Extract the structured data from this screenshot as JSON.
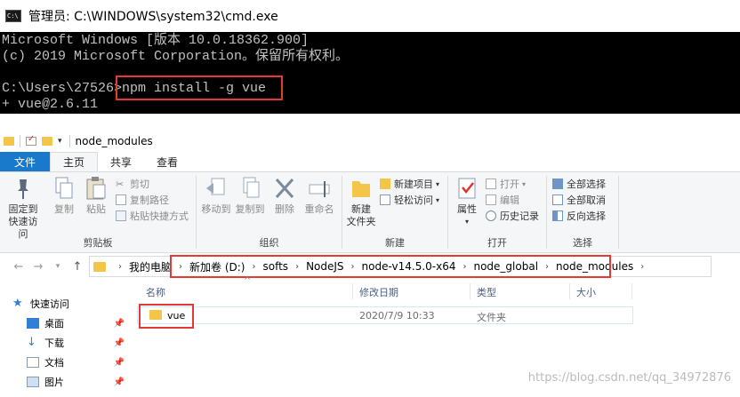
{
  "cmd": {
    "title": "管理员: C:\\WINDOWS\\system32\\cmd.exe",
    "lines": [
      "Microsoft Windows [版本 10.0.18362.900]",
      "(c) 2019 Microsoft Corporation。保留所有权利。",
      "",
      "C:\\Users\\27526>npm install -g vue",
      "+ vue@2.6.11"
    ]
  },
  "explorer": {
    "title": "node_modules",
    "tabs": [
      "文件",
      "主页",
      "共享",
      "查看"
    ],
    "ribbon": {
      "clipboard": {
        "label": "剪贴板",
        "pin_label": "固定到\n快速访问",
        "copy": "复制",
        "paste": "粘贴",
        "cut": "剪切",
        "copy_path": "复制路径",
        "paste_shortcut": "粘贴快捷方式"
      },
      "organize": {
        "label": "组织",
        "move_to": "移动到",
        "copy_to": "复制到",
        "delete": "删除",
        "rename": "重命名"
      },
      "new": {
        "label": "新建",
        "new_folder": "新建\n文件夹",
        "new_item": "新建项目",
        "easy_access": "轻松访问"
      },
      "open": {
        "label": "打开",
        "properties": "属性",
        "open": "打开",
        "edit": "编辑",
        "history": "历史记录"
      },
      "select": {
        "label": "选择",
        "select_all": "全部选择",
        "select_none": "全部取消",
        "invert": "反向选择"
      }
    },
    "address": [
      "我的电脑",
      "新加卷 (D:)",
      "softs",
      "NodeJS",
      "node-v14.5.0-x64",
      "node_global",
      "node_modules"
    ],
    "nav": {
      "items": [
        {
          "label": "快速访问"
        },
        {
          "label": "桌面"
        },
        {
          "label": "下载"
        },
        {
          "label": "文档"
        },
        {
          "label": "图片"
        }
      ]
    },
    "columns": {
      "name": "名称",
      "modified": "修改日期",
      "type": "类型",
      "size": "大小"
    },
    "files": [
      {
        "name": "vue",
        "modified": "2020/7/9 10:33",
        "type": "文件夹",
        "size": ""
      }
    ]
  },
  "watermark": "https://blog.csdn.net/qq_34972876",
  "colors": {
    "highlight": "#e53935",
    "file_tab": "#1979ca",
    "folder": "#f3c64a"
  }
}
